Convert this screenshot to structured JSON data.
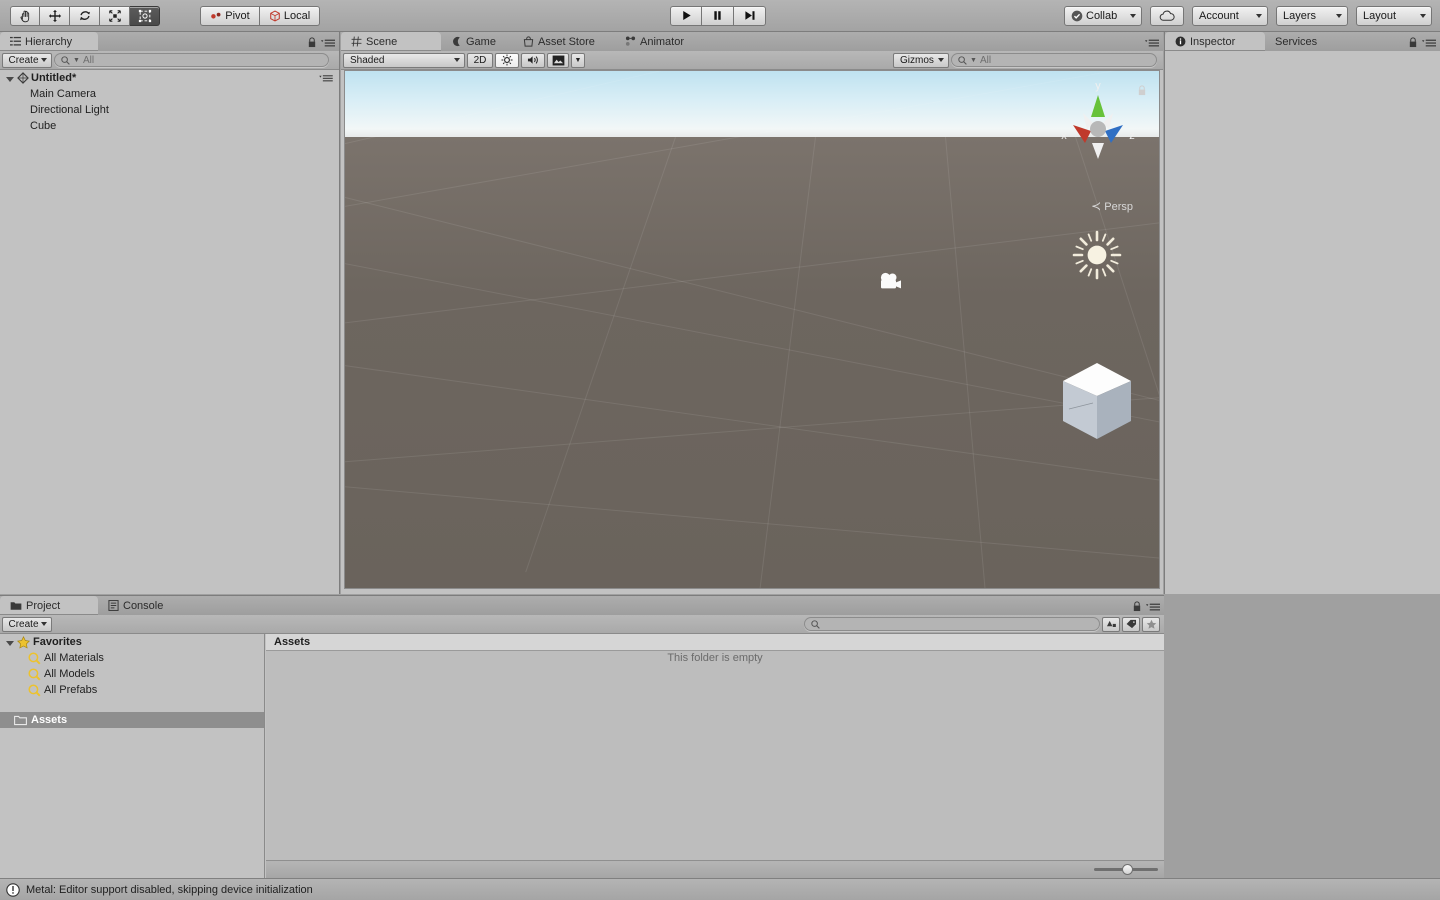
{
  "toolbar": {
    "tools": [
      {
        "name": "hand-tool",
        "icon": "hand-icon",
        "active": false
      },
      {
        "name": "move-tool",
        "icon": "move-icon",
        "active": false
      },
      {
        "name": "rotate-tool",
        "icon": "rotate-icon",
        "active": false
      },
      {
        "name": "scale-tool",
        "icon": "scale-icon",
        "active": false
      },
      {
        "name": "rect-tool",
        "icon": "rect-transform-icon",
        "active": true
      }
    ],
    "pivot_label": "Pivot",
    "local_label": "Local",
    "play_label": "Play",
    "pause_label": "Pause",
    "step_label": "Step",
    "collab_label": "Collab",
    "cloud_label": "",
    "account_label": "Account",
    "layers_label": "Layers",
    "layout_label": "Layout"
  },
  "hierarchy": {
    "tab_label": "Hierarchy",
    "create_label": "Create",
    "search_placeholder": "All",
    "scene_name": "Untitled*",
    "items": [
      {
        "label": "Main Camera"
      },
      {
        "label": "Directional Light"
      },
      {
        "label": "Cube"
      }
    ]
  },
  "scene": {
    "tabs": [
      {
        "label": "Scene",
        "icon": "grid-icon",
        "active": true
      },
      {
        "label": "Game",
        "icon": "gamepad-icon",
        "active": false
      },
      {
        "label": "Asset Store",
        "icon": "store-icon",
        "active": false
      },
      {
        "label": "Animator",
        "icon": "animator-icon",
        "active": false
      }
    ],
    "draw_mode": "Shaded",
    "mode_2d_label": "2D",
    "lighting_label": "Lighting",
    "audio_label": "Audio",
    "effects_label": "Effects",
    "gizmos_label": "Gizmos",
    "gizmo_search_placeholder": "All",
    "projection_label": "Persp",
    "axis_x": "x",
    "axis_y": "y",
    "axis_z": "z",
    "objects": [
      {
        "name": "directional-light-gizmo",
        "type": "sun"
      },
      {
        "name": "main-camera-gizmo",
        "type": "camera"
      },
      {
        "name": "cube-object",
        "type": "cube"
      }
    ],
    "colors": {
      "sky_top": "#bfe2f0",
      "horizon": "#f2f7f7",
      "ground": "#6d665f",
      "axis_x": "#c0392b",
      "axis_y": "#5dbd3a",
      "axis_z": "#2b6fc0"
    }
  },
  "inspector": {
    "tabs": [
      {
        "label": "Inspector",
        "active": true
      },
      {
        "label": "Services",
        "active": false
      }
    ]
  },
  "project": {
    "tabs": [
      {
        "label": "Project",
        "icon": "folder-icon",
        "active": true
      },
      {
        "label": "Console",
        "icon": "console-icon",
        "active": false
      }
    ],
    "create_label": "Create",
    "search_placeholder": "",
    "favorites_label": "Favorites",
    "favorites": [
      {
        "label": "All Materials"
      },
      {
        "label": "All Models"
      },
      {
        "label": "All Prefabs"
      }
    ],
    "assets_label": "Assets",
    "breadcrumb": "Assets",
    "empty_message": "This folder is empty",
    "zoom_value": 45
  },
  "status": {
    "message": "Metal: Editor support disabled, skipping device initialization",
    "icon": "warning-icon"
  }
}
